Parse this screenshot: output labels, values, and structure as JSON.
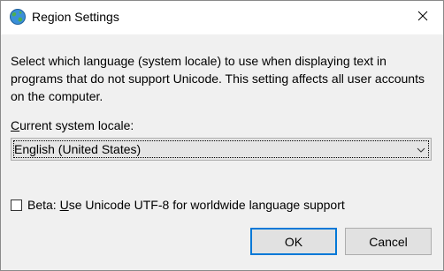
{
  "window": {
    "title": "Region Settings",
    "icon": "globe-icon",
    "close_icon": "close-icon"
  },
  "description": "Select which language (system locale) to use when displaying text in programs that do not support Unicode. This setting affects all user accounts on the computer.",
  "locale": {
    "label_mnemonic": "C",
    "label_rest": "urrent system locale:",
    "selected": "English (United States)"
  },
  "beta": {
    "label_prefix": "Beta: ",
    "label_mnemonic": "U",
    "label_rest": "se Unicode UTF-8 for worldwide language support",
    "checked": false
  },
  "buttons": {
    "ok": "OK",
    "cancel": "Cancel"
  },
  "colors": {
    "accent": "#0078d7",
    "background": "#f0f0f0",
    "titlebar": "#ffffff"
  }
}
